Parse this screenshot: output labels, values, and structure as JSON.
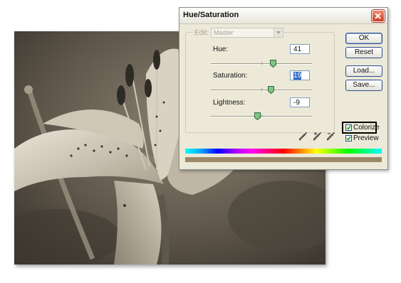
{
  "dialog": {
    "title": "Hue/Saturation",
    "edit_label": "Edit:",
    "edit_value": "Master",
    "hue": {
      "label": "Hue:",
      "value": "41",
      "level": 0.61
    },
    "saturation": {
      "label": "Saturation:",
      "value": "19",
      "level": 0.59
    },
    "lightness": {
      "label": "Lightness:",
      "value": "-9",
      "level": 0.455
    },
    "buttons": {
      "ok": "OK",
      "reset": "Reset",
      "load": "Load...",
      "save": "Save..."
    },
    "colorize": {
      "label": "Colorize",
      "checked": true
    },
    "preview": {
      "label": "Preview",
      "checked": true
    },
    "colors": {
      "spectrum_start": "#00ffff",
      "tone_bar": "#9b8868"
    }
  },
  "photo": {
    "subject": "sepia-lily-photo"
  }
}
